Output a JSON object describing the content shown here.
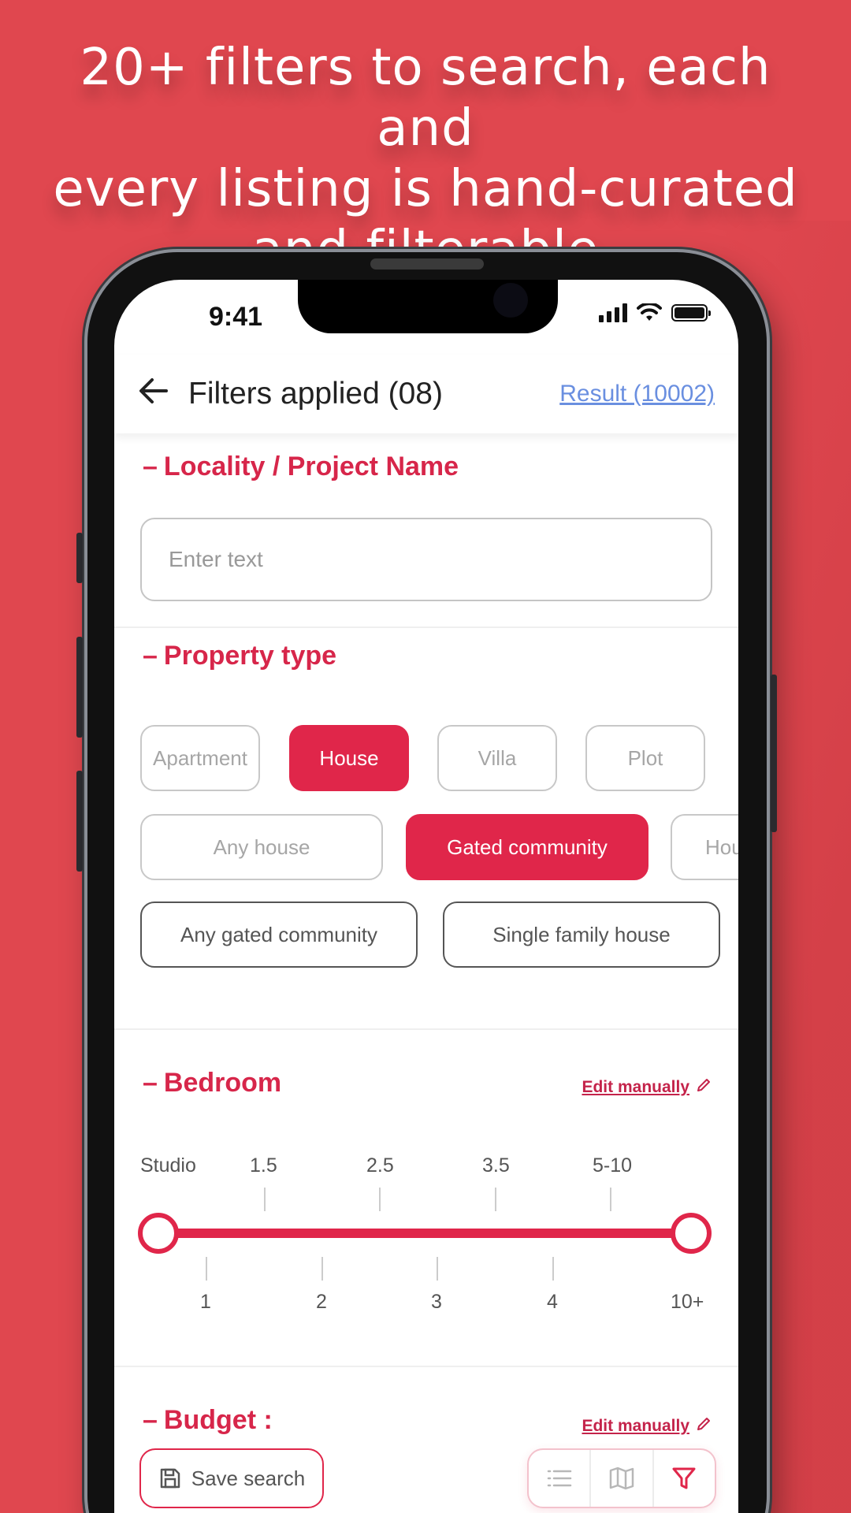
{
  "headline": {
    "line1": "20+ filters to search, each and",
    "line2": "every listing is hand-curated",
    "line3": "and filterable"
  },
  "status_bar": {
    "time": "9:41"
  },
  "app_bar": {
    "title": "Filters applied (08)",
    "result_link": "Result (10002)"
  },
  "locality": {
    "title": "Locality / Project Name",
    "placeholder": "Enter text"
  },
  "property_type": {
    "title": "Property type",
    "row1": [
      "Apartment",
      "House",
      "Villa",
      "Plot"
    ],
    "row2": [
      "Any house",
      "Gated community",
      "Hou"
    ],
    "row3": [
      "Any gated community",
      "Single family house"
    ]
  },
  "bedroom": {
    "title": "Bedroom",
    "edit_label": "Edit manually",
    "top_ticks": [
      "Studio",
      "1.5",
      "2.5",
      "3.5",
      "5-10"
    ],
    "bottom_ticks": [
      "1",
      "2",
      "3",
      "4",
      "10+"
    ],
    "range_min": "Studio",
    "range_max": "10+"
  },
  "budget": {
    "title": "Budget :",
    "edit_label": "Edit manually"
  },
  "bottom_bar": {
    "save_label": "Save search"
  },
  "colors": {
    "background": "#e0474f",
    "accent": "#e0264a",
    "link": "#6a8fe0"
  }
}
